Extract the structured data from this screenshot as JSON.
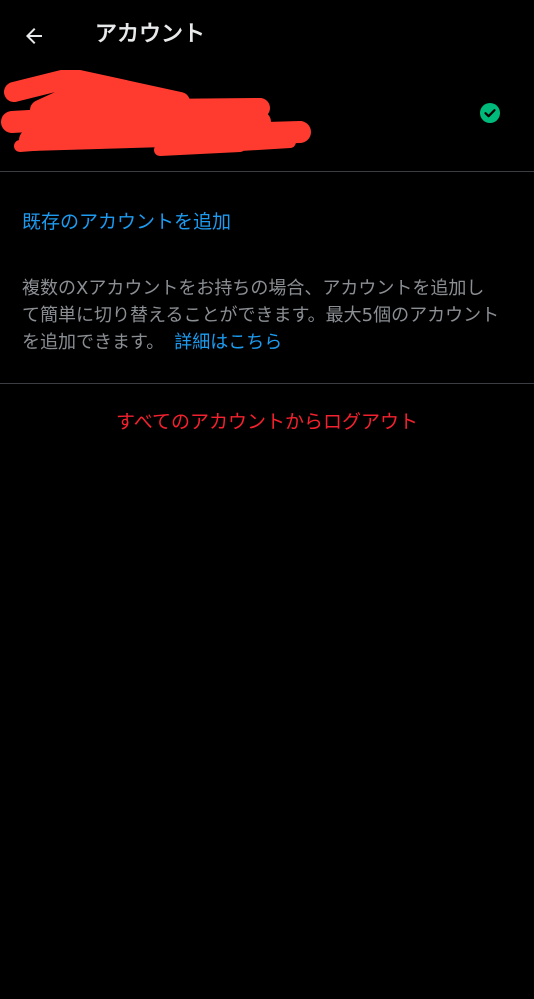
{
  "header": {
    "title": "アカウント",
    "back_icon": "arrow-left-icon"
  },
  "account": {
    "redacted": true,
    "status_icon": "check-circle-icon",
    "status_color": "#00ba7c",
    "redaction_color": "#ff3b30"
  },
  "actions": {
    "add_existing": "既存のアカウントを追加",
    "logout_all": "すべてのアカウントからログアウト"
  },
  "info": {
    "line1": "複数のXアカウントをお持ちの場合、アカウントを追加し",
    "line2": "て簡単に切り替えることができます。最大5個のアカウント",
    "line3": "を追加できます。",
    "learn_more": "詳細はこちら"
  },
  "colors": {
    "background": "#000000",
    "link": "#1d9bf0",
    "danger": "#f4212e",
    "muted": "#8b8f94"
  }
}
